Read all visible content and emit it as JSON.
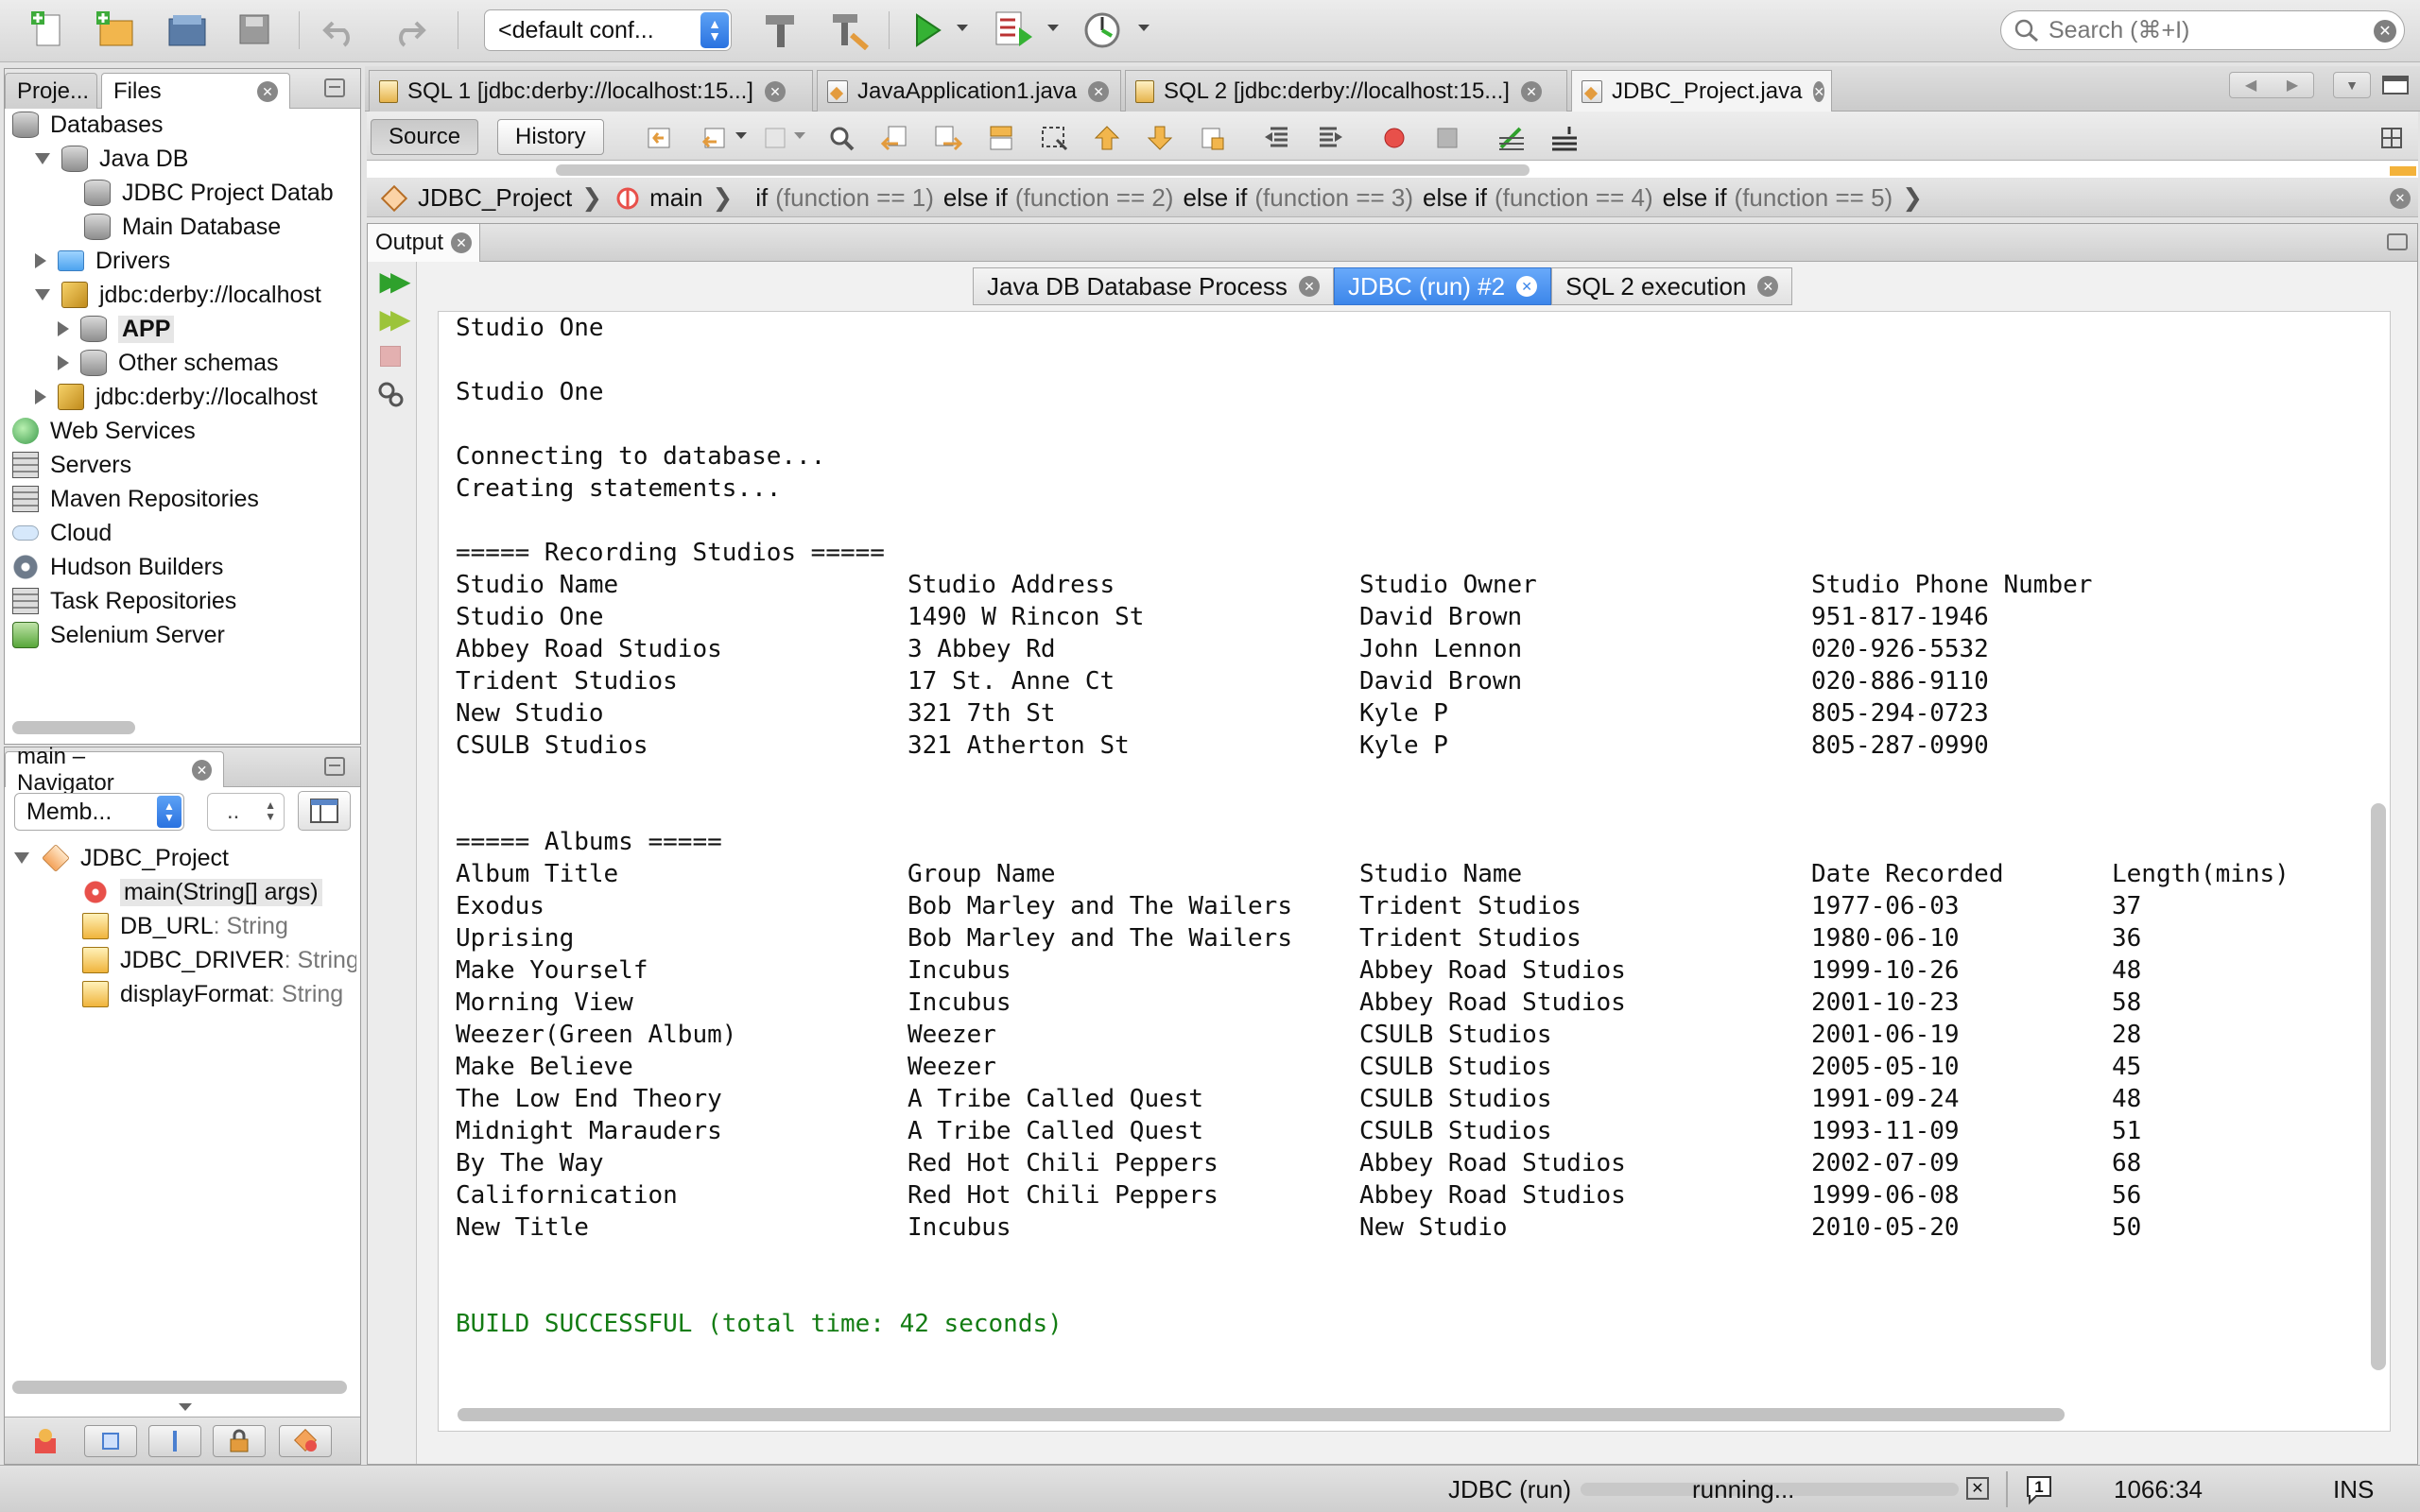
{
  "toolbar": {
    "config_value": "<default conf...",
    "search_placeholder": "Search (⌘+I)"
  },
  "projects_pane": {
    "tabs": [
      "Proje...",
      "Files"
    ],
    "tree": [
      {
        "label": "Databases",
        "icon": "database-icon",
        "level": 0
      },
      {
        "label": "Java DB",
        "icon": "database-icon",
        "level": 1,
        "expanded": true
      },
      {
        "label": "JDBC Project Datab",
        "icon": "database-icon",
        "level": 2
      },
      {
        "label": "Main Database",
        "icon": "database-icon",
        "level": 2
      },
      {
        "label": "Drivers",
        "icon": "folder-icon",
        "level": 1,
        "expanded": false
      },
      {
        "label": "jdbc:derby://localhost",
        "icon": "connection-icon",
        "level": 1,
        "expanded": true
      },
      {
        "label": "APP",
        "icon": "schema-icon",
        "level": 2,
        "expanded": false,
        "bold": true
      },
      {
        "label": "Other schemas",
        "icon": "schema-icon",
        "level": 2,
        "expanded": false
      },
      {
        "label": "jdbc:derby://localhost",
        "icon": "connection-icon",
        "level": 1,
        "expanded": false
      },
      {
        "label": "Web Services",
        "icon": "globe-icon",
        "level": 0
      },
      {
        "label": "Servers",
        "icon": "server-icon",
        "level": 0
      },
      {
        "label": "Maven Repositories",
        "icon": "server-icon",
        "level": 0
      },
      {
        "label": "Cloud",
        "icon": "cloud-icon",
        "level": 0
      },
      {
        "label": "Hudson Builders",
        "icon": "gear-icon",
        "level": 0
      },
      {
        "label": "Task Repositories",
        "icon": "server-icon",
        "level": 0
      },
      {
        "label": "Selenium Server",
        "icon": "selenium-icon",
        "level": 0
      }
    ]
  },
  "navigator": {
    "title": "main – Navigator",
    "filter_value": "Memb...",
    "second_value": "..",
    "items": [
      {
        "label": "JDBC_Project",
        "type": ""
      },
      {
        "label": "main(String[] args)",
        "type": ""
      },
      {
        "label": "DB_URL",
        "type": " : String"
      },
      {
        "label": "JDBC_DRIVER",
        "type": " : String"
      },
      {
        "label": "displayFormat",
        "type": " : String"
      }
    ]
  },
  "editor_tabs": [
    {
      "label": "SQL 1 [jdbc:derby://localhost:15...]",
      "kind": "sql"
    },
    {
      "label": "JavaApplication1.java",
      "kind": "java"
    },
    {
      "label": "SQL 2 [jdbc:derby://localhost:15...]",
      "kind": "sql"
    },
    {
      "label": "JDBC_Project.java",
      "kind": "java",
      "active": true
    }
  ],
  "editor_toolbar": {
    "source_label": "Source",
    "history_label": "History"
  },
  "breadcrumb": {
    "project": "JDBC_Project",
    "method": "main",
    "conditions": [
      {
        "kw": "if",
        "cond": "(function == 1)"
      },
      {
        "kw": "else if",
        "cond": "(function == 2)"
      },
      {
        "kw": "else if",
        "cond": "(function == 3)"
      },
      {
        "kw": "else if",
        "cond": "(function == 4)"
      },
      {
        "kw": "else if",
        "cond": "(function == 5)"
      }
    ]
  },
  "output": {
    "title": "Output",
    "subtabs": [
      {
        "label": "Java DB Database Process",
        "active": false
      },
      {
        "label": "JDBC (run) #2",
        "active": true
      },
      {
        "label": "SQL 2 execution",
        "active": false
      }
    ],
    "lines_top": [
      "Studio One",
      "",
      "Studio One",
      "",
      "Connecting to database...",
      "Creating statements...",
      ""
    ],
    "studios_header": "===== Recording Studios =====",
    "studios_columns": [
      "Studio Name",
      "Studio Address",
      "Studio Owner",
      "Studio Phone Number"
    ],
    "studios_rows": [
      [
        "Studio One",
        "1490 W Rincon St",
        "David Brown",
        "951-817-1946"
      ],
      [
        "Abbey Road Studios",
        "3 Abbey Rd",
        "John Lennon",
        "020-926-5532"
      ],
      [
        "Trident Studios",
        "17 St. Anne Ct",
        "David Brown",
        "020-886-9110"
      ],
      [
        "New Studio",
        "321 7th St",
        "Kyle P",
        "805-294-0723"
      ],
      [
        "CSULB Studios",
        "321 Atherton St",
        "Kyle P",
        "805-287-0990"
      ]
    ],
    "albums_header": "===== Albums =====",
    "albums_columns": [
      "Album Title",
      "Group Name",
      "Studio Name",
      "Date Recorded",
      "Length(mins)"
    ],
    "albums_rows": [
      [
        "Exodus",
        "Bob Marley and The Wailers",
        "Trident Studios",
        "1977-06-03",
        "37"
      ],
      [
        "Uprising",
        "Bob Marley and The Wailers",
        "Trident Studios",
        "1980-06-10",
        "36"
      ],
      [
        "Make Yourself",
        "Incubus",
        "Abbey Road Studios",
        "1999-10-26",
        "48"
      ],
      [
        "Morning View",
        "Incubus",
        "Abbey Road Studios",
        "2001-10-23",
        "58"
      ],
      [
        "Weezer(Green Album)",
        "Weezer",
        "CSULB Studios",
        "2001-06-19",
        "28"
      ],
      [
        "Make Believe",
        "Weezer",
        "CSULB Studios",
        "2005-05-10",
        "45"
      ],
      [
        "The Low End Theory",
        "A Tribe Called Quest",
        "CSULB Studios",
        "1991-09-24",
        "48"
      ],
      [
        "Midnight Marauders",
        "A Tribe Called Quest",
        "CSULB Studios",
        "1993-11-09",
        "51"
      ],
      [
        "By The Way",
        "Red Hot Chili Peppers",
        "Abbey Road Studios",
        "2002-07-09",
        "68"
      ],
      [
        "Californication",
        "Red Hot Chili Peppers",
        "Abbey Road Studios",
        "1999-06-08",
        "56"
      ],
      [
        "New Title",
        "Incubus",
        "New Studio",
        "2010-05-20",
        "50"
      ]
    ],
    "build_status": "BUILD SUCCESSFUL (total time: 42 seconds)"
  },
  "status_bar": {
    "task": "JDBC (run)",
    "progress_text": "running...",
    "notifications": "1",
    "position": "1066:34",
    "mode": "INS"
  },
  "colors": {
    "active_tab": "#3c86ea",
    "success_text": "#137c13",
    "run_green": "#2fa12c"
  }
}
